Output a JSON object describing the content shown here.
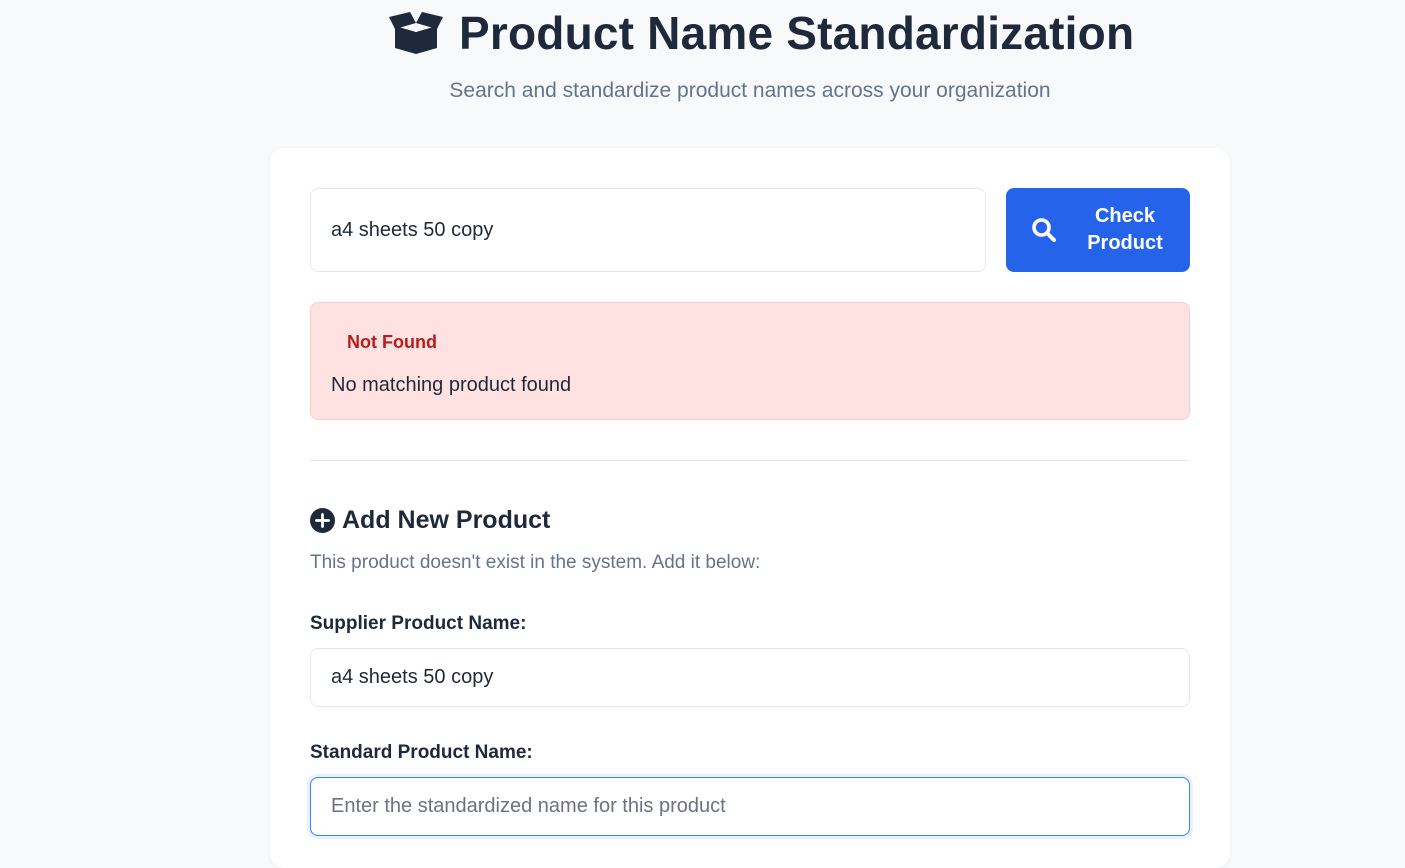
{
  "header": {
    "icon": "open-box-icon",
    "title": "Product Name Standardization",
    "subtitle": "Search and standardize product names across your organization"
  },
  "search": {
    "value": "a4 sheets 50 copy",
    "button_icon": "search-icon",
    "button_label": "Check Product",
    "button_color": "#2563eb"
  },
  "result": {
    "status": "Not Found",
    "message": "No matching product found",
    "status_color": "#b91c1c",
    "background_color": "#fee2e2"
  },
  "add_product": {
    "icon": "plus-circle-icon",
    "title": "Add New Product",
    "description": "This product doesn't exist in the system. Add it below:",
    "supplier_label": "Supplier Product Name:",
    "supplier_value": "a4 sheets 50 copy",
    "standard_label": "Standard Product Name:",
    "standard_placeholder": "Enter the standardized name for this product"
  }
}
